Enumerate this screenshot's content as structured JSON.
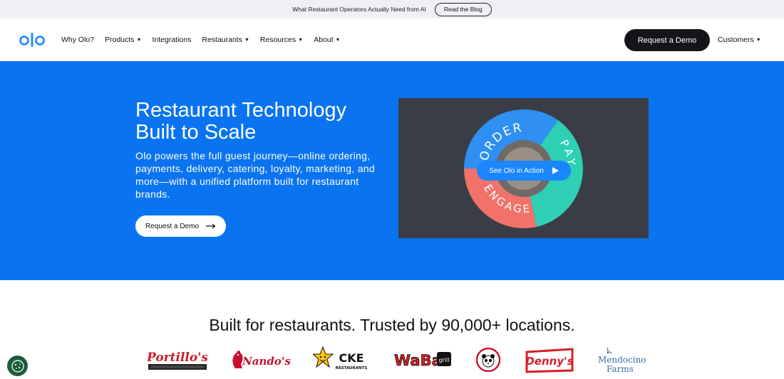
{
  "announcement": {
    "text": "What Restaurant Operators Actually Need from AI",
    "button": "Read the Blog"
  },
  "nav": {
    "logo_alt": "olo",
    "links": [
      {
        "label": "Why Olo?",
        "dropdown": false
      },
      {
        "label": "Products",
        "dropdown": true
      },
      {
        "label": "Integrations",
        "dropdown": false
      },
      {
        "label": "Restaurants",
        "dropdown": true
      },
      {
        "label": "Resources",
        "dropdown": true
      },
      {
        "label": "About",
        "dropdown": true
      }
    ],
    "demo_button": "Request a Demo",
    "customers": "Customers"
  },
  "hero": {
    "title": "Restaurant Technology Built to Scale",
    "subtitle": "Olo powers the full guest journey—online ordering, payments, delivery, catering, loyalty, marketing, and more—with a unified platform built for restaurant brands.",
    "button": "Request a Demo",
    "video": {
      "play_label": "See Olo in Action",
      "wheel_labels": [
        "ORDER",
        "PAY",
        "ENGAGE"
      ],
      "colors": {
        "order": "#2f8ff2",
        "pay": "#2ecfb4",
        "engage": "#f0726a"
      }
    }
  },
  "trust": {
    "title": "Built for restaurants. Trusted by 90,000+ locations.",
    "brands": [
      "Portillo's",
      "Nando's",
      "CKE Restaurants",
      "WaBa Grill",
      "Panda Express",
      "Denny's",
      "Mendocino Farms"
    ]
  },
  "colors": {
    "hero_blue": "#0a74f0",
    "nav_dark": "#131518",
    "cookie_green": "#1c5b3c"
  }
}
